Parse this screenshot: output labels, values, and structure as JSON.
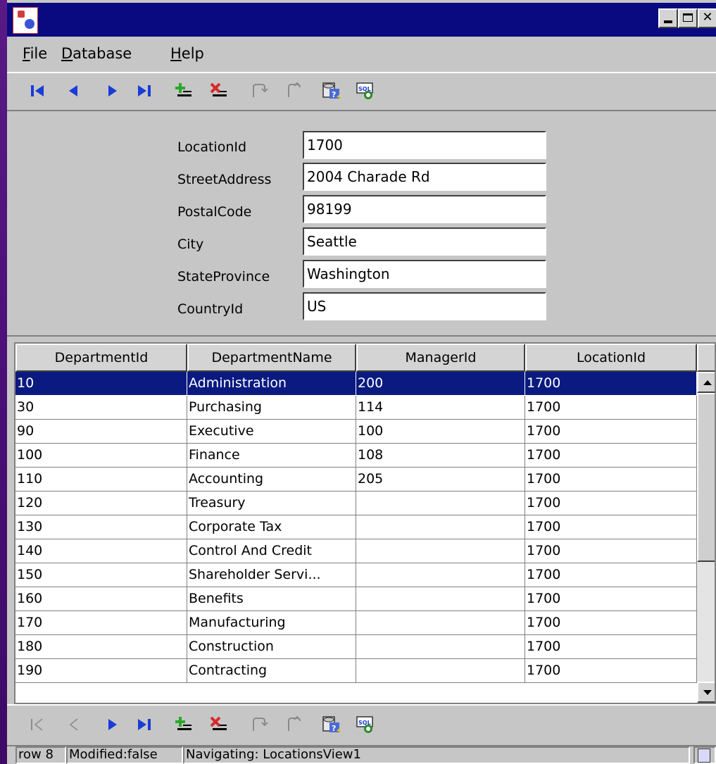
{
  "window": {
    "controls": [
      "minimize",
      "maximize",
      "close"
    ]
  },
  "menu": {
    "items": [
      {
        "label": "File",
        "mnemonic": "F"
      },
      {
        "label": "Database",
        "mnemonic": "D"
      },
      {
        "label": "Help",
        "mnemonic": "H"
      }
    ]
  },
  "toolbar": {
    "buttons": [
      "first-record-icon",
      "previous-record-icon",
      "next-record-icon",
      "last-record-icon",
      "insert-record-icon",
      "delete-record-icon",
      "commit-icon",
      "rollback-icon",
      "find-icon",
      "sql-icon"
    ]
  },
  "form": {
    "fields": [
      {
        "label": "LocationId",
        "value": "1700"
      },
      {
        "label": "StreetAddress",
        "value": "2004 Charade Rd"
      },
      {
        "label": "PostalCode",
        "value": "98199"
      },
      {
        "label": "City",
        "value": "Seattle"
      },
      {
        "label": "StateProvince",
        "value": "Washington"
      },
      {
        "label": "CountryId",
        "value": "US"
      }
    ]
  },
  "table": {
    "columns": [
      "DepartmentId",
      "DepartmentName",
      "ManagerId",
      "LocationId"
    ],
    "selected_row": 0,
    "rows": [
      [
        "10",
        "Administration",
        "200",
        "1700"
      ],
      [
        "30",
        "Purchasing",
        "114",
        "1700"
      ],
      [
        "90",
        "Executive",
        "100",
        "1700"
      ],
      [
        "100",
        "Finance",
        "108",
        "1700"
      ],
      [
        "110",
        "Accounting",
        "205",
        "1700"
      ],
      [
        "120",
        "Treasury",
        "",
        "1700"
      ],
      [
        "130",
        "Corporate Tax",
        "",
        "1700"
      ],
      [
        "140",
        "Control And Credit",
        "",
        "1700"
      ],
      [
        "150",
        "Shareholder Servi...",
        "",
        "1700"
      ],
      [
        "160",
        "Benefits",
        "",
        "1700"
      ],
      [
        "170",
        "Manufacturing",
        "",
        "1700"
      ],
      [
        "180",
        "Construction",
        "",
        "1700"
      ],
      [
        "190",
        "Contracting",
        "",
        "1700"
      ]
    ]
  },
  "status": {
    "row": "row 8",
    "modified": "Modified:false",
    "navigating": "Navigating: LocationsView1"
  },
  "colors": {
    "title_bar": "#0a0a80",
    "selection": "#0a1a80",
    "window_bg": "#c6c6c6",
    "desktop": "#4a0f76",
    "nav_arrow": "#1a3cd6",
    "insert": "#2aa82a",
    "delete": "#d62a2a"
  }
}
